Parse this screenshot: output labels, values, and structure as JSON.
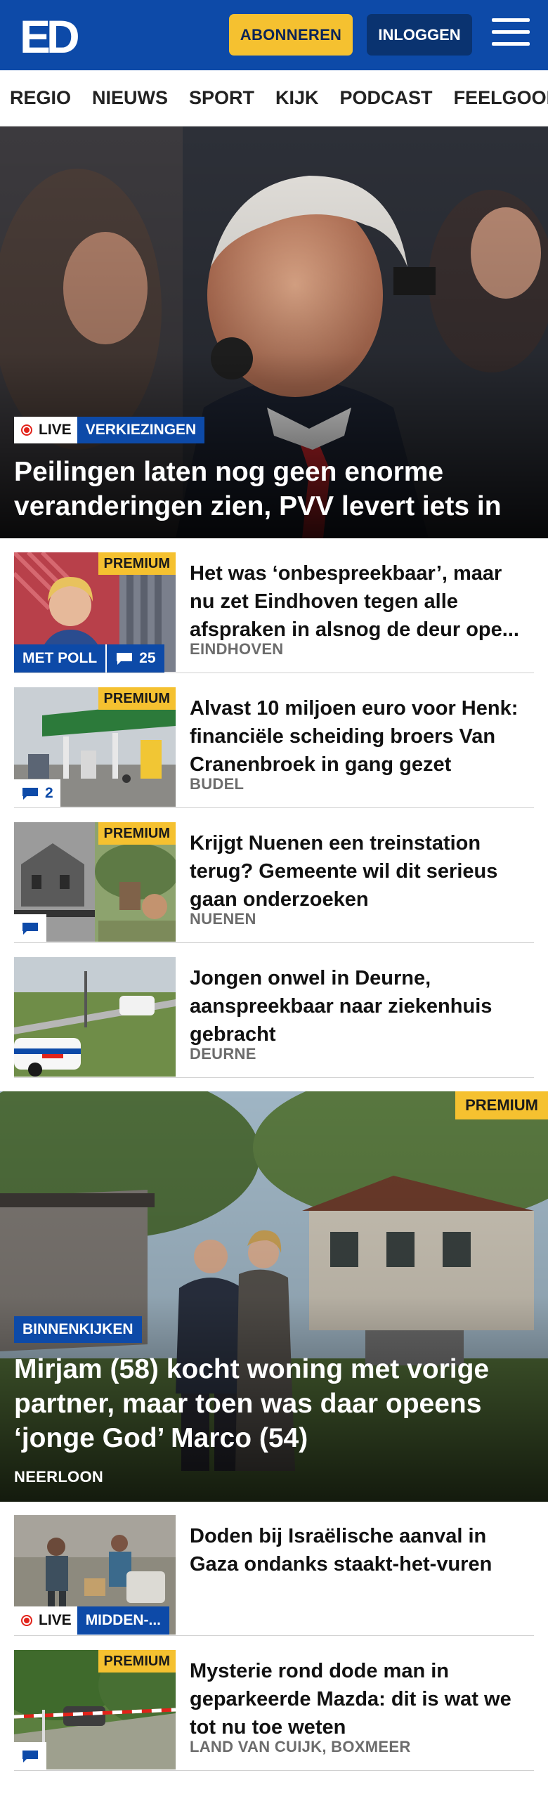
{
  "header": {
    "logo_text": "ED",
    "subscribe_label": "ABONNEREN",
    "login_label": "INLOGGEN",
    "menu_icon": "hamburger-menu-icon",
    "brand_color": "#0d4aa8",
    "accent_color": "#f5c130"
  },
  "nav": {
    "items": [
      "REGIO",
      "NIEUWS",
      "SPORT",
      "KIJK",
      "PODCAST",
      "FEELGOOD"
    ]
  },
  "hero": {
    "live_label": "LIVE",
    "category": "VERKIEZINGEN",
    "title": "Peilingen laten nog geen enorme veranderingen zien, PVV levert iets in"
  },
  "articles": [
    {
      "premium": "PREMIUM",
      "title": "Het was ‘onbespreekbaar’, maar nu zet Eindhoven tegen alle afspraken in alsnog de deur ope...",
      "location": "EINDHOVEN",
      "poll_label": "MET POLL",
      "comment_count": "25"
    },
    {
      "premium": "PREMIUM",
      "title": "Alvast 10 miljoen euro voor Henk: financiële scheiding broers Van Cranenbroek in gang gezet",
      "location": "BUDEL",
      "comment_count": "2"
    },
    {
      "premium": "PREMIUM",
      "title": "Krijgt Nuenen een treinstation terug? Gemeente wil dit serieus gaan onderzoeken",
      "location": "NUENEN",
      "comment_count": ""
    },
    {
      "title": "Jongen onwel in Deurne, aanspreekbaar naar ziekenhuis gebracht",
      "location": "DEURNE"
    }
  ],
  "feature": {
    "premium": "PREMIUM",
    "category": "BINNENKIJKEN",
    "title": "Mirjam (58) kocht woning met vorige partner, maar toen was daar opeens ‘jonge God’ Marco (54)",
    "location": "NEERLOON"
  },
  "articles_after": [
    {
      "title": "Doden bij Israëlische aanval in Gaza ondanks staakt-het-vuren",
      "live_label": "LIVE",
      "category": "MIDDEN-..."
    },
    {
      "premium": "PREMIUM",
      "title": "Mysterie rond dode man in geparkeerde Mazda: dit is wat we tot nu toe weten",
      "location": "LAND VAN CUIJK, BOXMEER",
      "comment_count": ""
    }
  ]
}
